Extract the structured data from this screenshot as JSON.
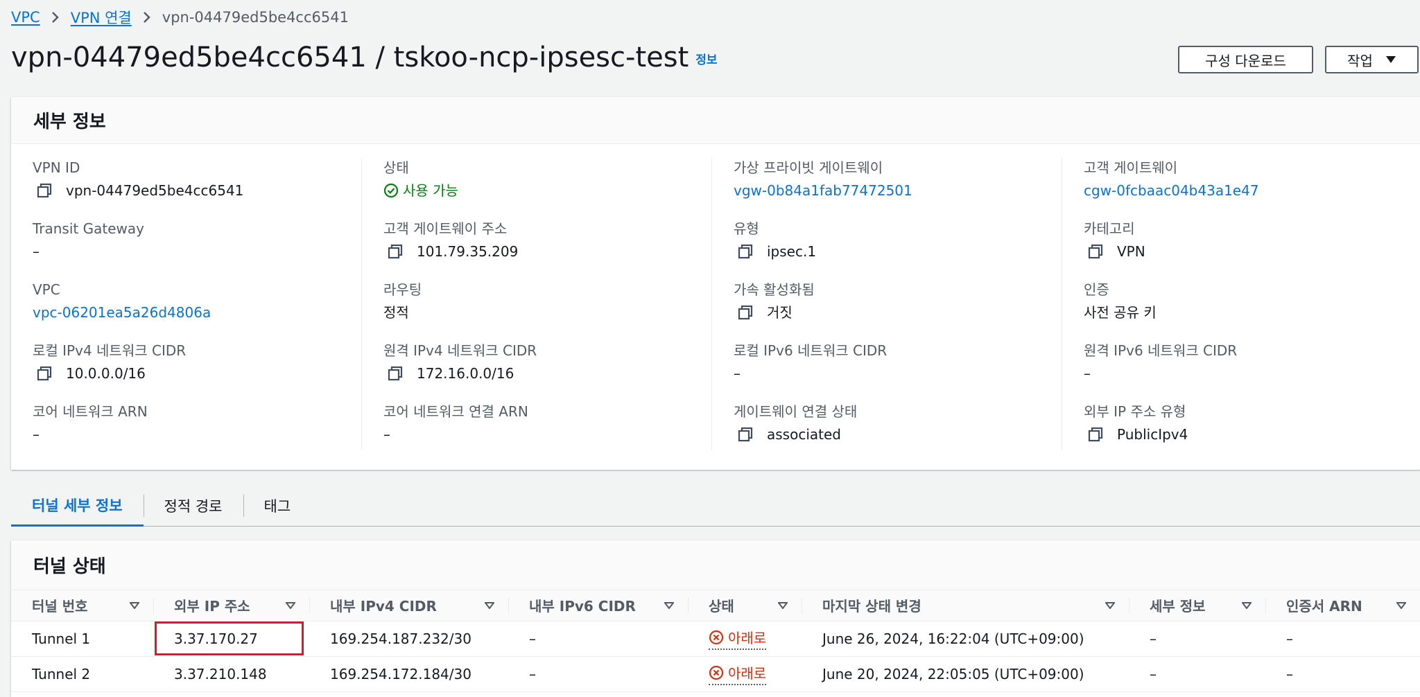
{
  "breadcrumb": {
    "items": [
      "VPC",
      "VPN 연결"
    ],
    "current": "vpn-04479ed5be4cc6541"
  },
  "header": {
    "title": "vpn-04479ed5be4cc6541 / tskoo-ncp-ipsesc-test",
    "info": "정보",
    "download_button": "구성 다운로드",
    "actions_button": "작업"
  },
  "details": {
    "heading": "세부 정보",
    "col1": {
      "vpn_id": {
        "label": "VPN ID",
        "value": "vpn-04479ed5be4cc6541"
      },
      "transit_gateway": {
        "label": "Transit Gateway",
        "value": "–"
      },
      "vpc": {
        "label": "VPC",
        "value": "vpc-06201ea5a26d4806a"
      },
      "local_ipv4": {
        "label": "로컬 IPv4 네트워크 CIDR",
        "value": "10.0.0.0/16"
      },
      "core_arn": {
        "label": "코어 네트워크 ARN",
        "value": "–"
      }
    },
    "col2": {
      "state": {
        "label": "상태",
        "value": "사용 가능"
      },
      "cgw_address": {
        "label": "고객 게이트웨이 주소",
        "value": "101.79.35.209"
      },
      "routing": {
        "label": "라우팅",
        "value": "정적"
      },
      "remote_ipv4": {
        "label": "원격 IPv4 네트워크 CIDR",
        "value": "172.16.0.0/16"
      },
      "core_attach_arn": {
        "label": "코어 네트워크 연결 ARN",
        "value": "–"
      }
    },
    "col3": {
      "vgw": {
        "label": "가상 프라이빗 게이트웨이",
        "value": "vgw-0b84a1fab77472501"
      },
      "type": {
        "label": "유형",
        "value": "ipsec.1"
      },
      "acceleration": {
        "label": "가속 활성화됨",
        "value": "거짓"
      },
      "local_ipv6": {
        "label": "로컬 IPv6 네트워크 CIDR",
        "value": "–"
      },
      "gw_assoc": {
        "label": "게이트웨이 연결 상태",
        "value": "associated"
      }
    },
    "col4": {
      "cgw": {
        "label": "고객 게이트웨이",
        "value": "cgw-0fcbaac04b43a1e47"
      },
      "category": {
        "label": "카테고리",
        "value": "VPN"
      },
      "auth": {
        "label": "인증",
        "value": "사전 공유 키"
      },
      "remote_ipv6": {
        "label": "원격 IPv6 네트워크 CIDR",
        "value": "–"
      },
      "outside_ip_type": {
        "label": "외부 IP 주소 유형",
        "value": "PublicIpv4"
      }
    }
  },
  "tabs": [
    "터널 세부 정보",
    "정적 경로",
    "태그"
  ],
  "tunnels": {
    "heading": "터널 상태",
    "columns": [
      "터널 번호",
      "외부 IP 주소",
      "내부 IPv4 CIDR",
      "내부 IPv6 CIDR",
      "상태",
      "마지막 상태 변경",
      "세부 정보",
      "인증서 ARN"
    ],
    "rows": [
      [
        "Tunnel 1",
        "3.37.170.27",
        "169.254.187.232/30",
        "–",
        "아래로",
        "June 26, 2024, 16:22:04 (UTC+09:00)",
        "–",
        "–"
      ],
      [
        "Tunnel 2",
        "3.37.210.148",
        "169.254.172.184/30",
        "–",
        "아래로",
        "June 20, 2024, 22:05:05 (UTC+09:00)",
        "–",
        "–"
      ]
    ]
  },
  "colors": {
    "link": "#0972d3",
    "success": "#037f0c",
    "error": "#d13212",
    "highlight": "#e0142d"
  }
}
